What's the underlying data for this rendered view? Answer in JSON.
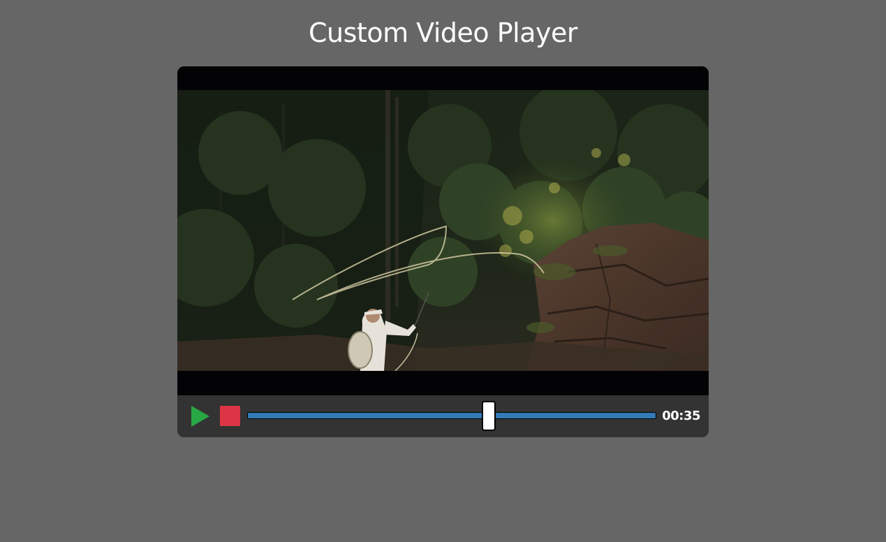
{
  "page": {
    "title": "Custom Video Player",
    "background_color": "#666666"
  },
  "player": {
    "video": {
      "description_icon": "video-frame"
    },
    "controls": {
      "play_icon": "play-icon",
      "play_color": "#28a745",
      "stop_icon": "stop-icon",
      "stop_color": "#dc3545",
      "progress": {
        "fraction": 0.59,
        "track_color": "#337ab7"
      },
      "timestamp": "00:35"
    }
  }
}
